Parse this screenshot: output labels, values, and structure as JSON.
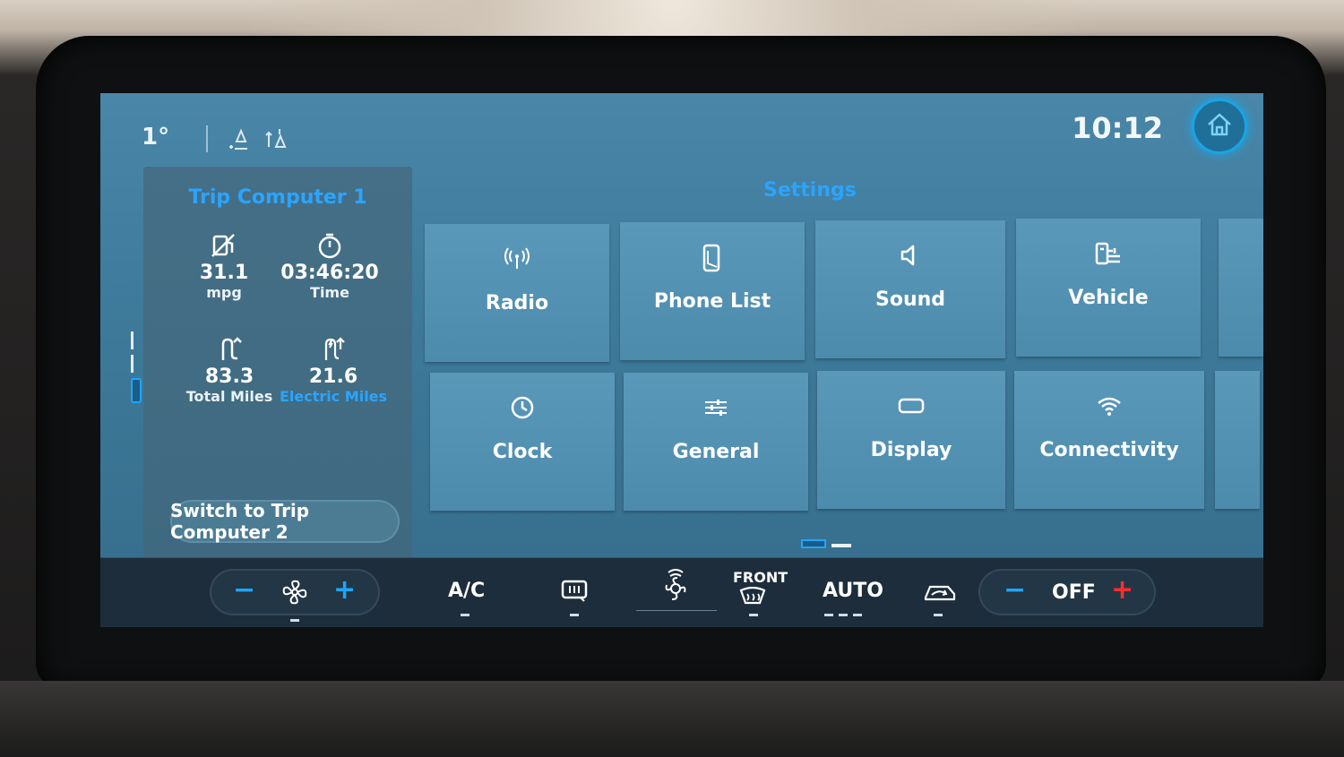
{
  "statusbar": {
    "temperature": "1°",
    "clock": "10:12"
  },
  "trip_panel": {
    "title": "Trip Computer 1",
    "stats": [
      {
        "value": "31.1",
        "label": "mpg",
        "icon": "fuel-economy-icon"
      },
      {
        "value": "03:46:20",
        "label": "Time",
        "icon": "stopwatch-icon"
      },
      {
        "value": "83.3",
        "label": "Total Miles",
        "icon": "total-miles-icon"
      },
      {
        "value": "21.6",
        "label": "Electric Miles",
        "icon": "electric-miles-icon"
      }
    ],
    "switch_label": "Switch to Trip Computer 2"
  },
  "settings": {
    "title": "Settings",
    "tiles": [
      {
        "label": "Radio",
        "icon": "antenna-icon"
      },
      {
        "label": "Phone List",
        "icon": "phone-icon"
      },
      {
        "label": "Sound",
        "icon": "speaker-icon"
      },
      {
        "label": "Vehicle",
        "icon": "vehicle-settings-icon"
      },
      {
        "label": "Clock",
        "icon": "clock-icon"
      },
      {
        "label": "General",
        "icon": "sliders-icon"
      },
      {
        "label": "Display",
        "icon": "display-icon"
      },
      {
        "label": "Connectivity",
        "icon": "wifi-icon"
      }
    ]
  },
  "climate": {
    "ac_label": "A/C",
    "front_label": "FRONT",
    "auto_label": "AUTO",
    "temp_off_label": "OFF"
  },
  "colors": {
    "accent": "#1da6ff",
    "screen_bg": "#3e7a9b",
    "tile": "#5494b6",
    "climate_bar": "#1d2d3b",
    "increase_red": "#ff2e2e"
  }
}
